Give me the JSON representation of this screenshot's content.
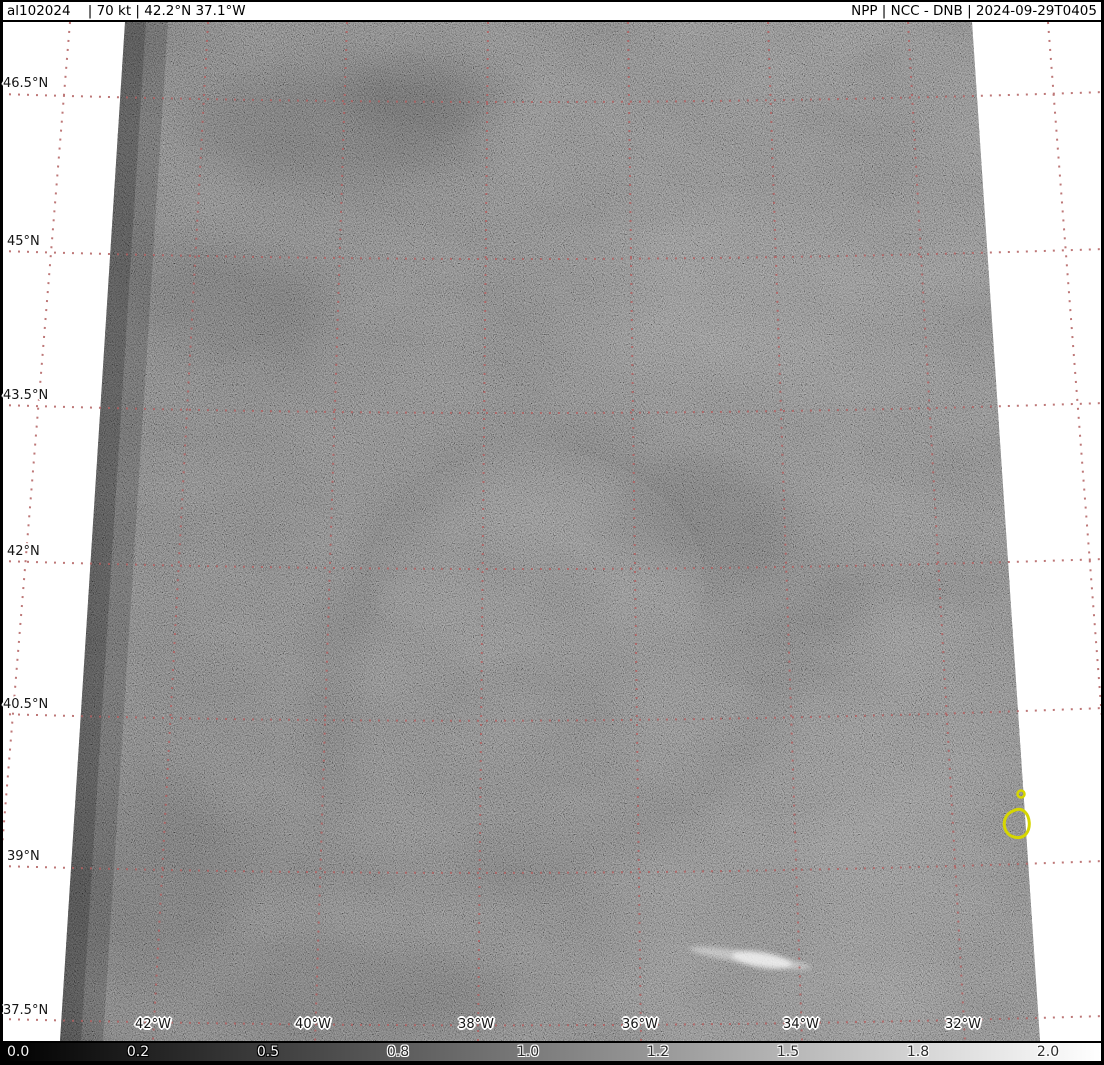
{
  "title_bar": {
    "left_text": "al102024    | 70 kt | 42.2°N 37.1°W",
    "right_text": "NPP | NCC - DNB | 2024-09-29T0405",
    "storm_id": "al102024",
    "intensity": "70 kt",
    "center_position": "42.2°N 37.1°W",
    "satellite": "NPP",
    "product": "NCC - DNB",
    "datetime": "2024-09-29T0405"
  },
  "map": {
    "lat_labels": [
      "46.5°N",
      "45°N",
      "43.5°N",
      "42°N",
      "40.5°N",
      "39°N",
      "37.5°N"
    ],
    "lon_labels": [
      "42°W",
      "40°W",
      "38°W",
      "36°W",
      "34°W",
      "32°W"
    ],
    "grid_color": "#b26060",
    "contour_color": "#d6d600",
    "background_color": "#ffffff",
    "swath_tone": "#717171"
  },
  "colorbar": {
    "ticks": [
      "0.0",
      "0.2",
      "0.5",
      "0.8",
      "1.0",
      "1.2",
      "1.5",
      "1.8",
      "2.0"
    ],
    "gradient": [
      "#000000",
      "#ffffff"
    ]
  }
}
